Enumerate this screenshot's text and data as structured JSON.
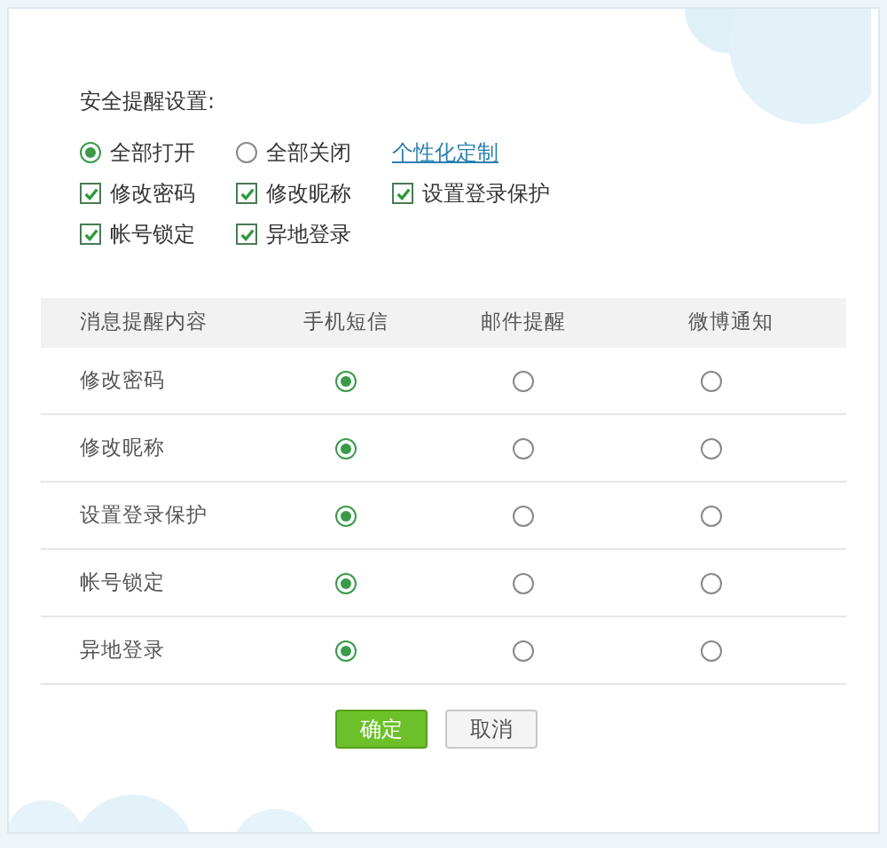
{
  "title": "安全提醒设置:",
  "modes": [
    {
      "label": "全部打开",
      "selected": true
    },
    {
      "label": "全部关闭",
      "selected": false
    }
  ],
  "custom_link": "个性化定制",
  "items": [
    {
      "label": "修改密码",
      "checked": true
    },
    {
      "label": "修改昵称",
      "checked": true
    },
    {
      "label": "设置登录保护",
      "checked": true
    },
    {
      "label": "帐号锁定",
      "checked": true
    },
    {
      "label": "异地登录",
      "checked": true
    }
  ],
  "table": {
    "columns": [
      "消息提醒内容",
      "手机短信",
      "邮件提醒",
      "微博通知"
    ],
    "rows": [
      {
        "label": "修改密码",
        "channels": [
          {
            "selected": true
          },
          {
            "selected": false
          },
          {
            "selected": false
          }
        ]
      },
      {
        "label": "修改昵称",
        "channels": [
          {
            "selected": true
          },
          {
            "selected": false
          },
          {
            "selected": false
          }
        ]
      },
      {
        "label": "设置登录保护",
        "channels": [
          {
            "selected": true
          },
          {
            "selected": false
          },
          {
            "selected": false
          }
        ]
      },
      {
        "label": "帐号锁定",
        "channels": [
          {
            "selected": true
          },
          {
            "selected": false
          },
          {
            "selected": false
          }
        ]
      },
      {
        "label": "异地登录",
        "channels": [
          {
            "selected": true
          },
          {
            "selected": false
          },
          {
            "selected": false
          }
        ]
      }
    ]
  },
  "buttons": [
    {
      "label": "确定",
      "kind": "primary"
    },
    {
      "label": "取消",
      "kind": "secondary"
    }
  ]
}
